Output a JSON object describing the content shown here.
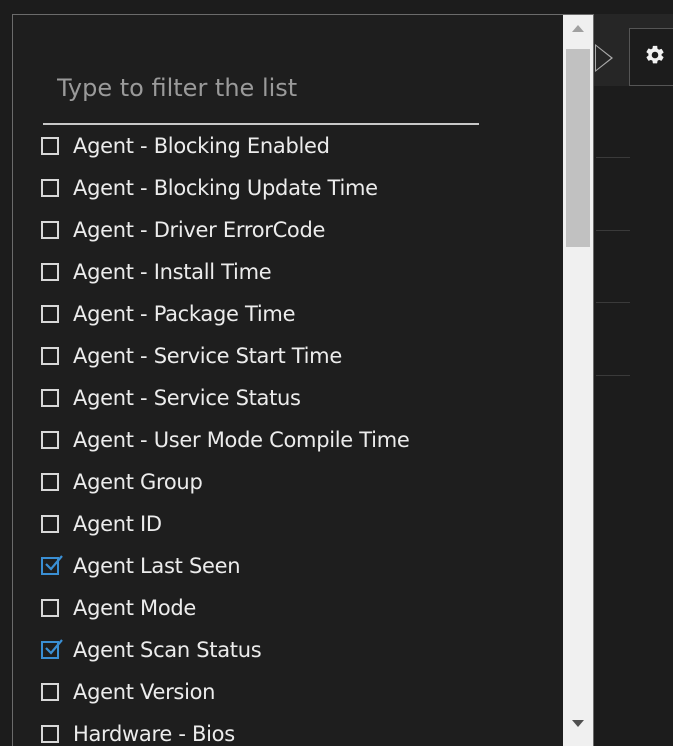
{
  "filter": {
    "placeholder": "Type to filter the list",
    "value": ""
  },
  "items": [
    {
      "label": "Agent - Blocking Enabled",
      "checked": false
    },
    {
      "label": "Agent - Blocking Update Time",
      "checked": false
    },
    {
      "label": "Agent - Driver ErrorCode",
      "checked": false
    },
    {
      "label": "Agent - Install Time",
      "checked": false
    },
    {
      "label": "Agent - Package Time",
      "checked": false
    },
    {
      "label": "Agent - Service Start Time",
      "checked": false
    },
    {
      "label": "Agent - Service Status",
      "checked": false
    },
    {
      "label": "Agent - User Mode Compile Time",
      "checked": false
    },
    {
      "label": "Agent Group",
      "checked": false
    },
    {
      "label": "Agent ID",
      "checked": false
    },
    {
      "label": "Agent Last Seen",
      "checked": true
    },
    {
      "label": "Agent Mode",
      "checked": false
    },
    {
      "label": "Agent Scan Status",
      "checked": true
    },
    {
      "label": "Agent Version",
      "checked": false
    },
    {
      "label": "Hardware - Bios",
      "checked": false
    }
  ],
  "icons": {
    "settings": "gear-icon",
    "expand": "caret-right-icon",
    "checkbox": "checkbox-icon",
    "scroll_up": "arrow-up-icon",
    "scroll_down": "arrow-down-icon"
  },
  "colors": {
    "background": "#1e1e1e",
    "text": "#ececec",
    "check_accent": "#3a8fd4",
    "scrollbar_track": "#f0f0f0",
    "scrollbar_thumb": "#c1c1c1"
  }
}
